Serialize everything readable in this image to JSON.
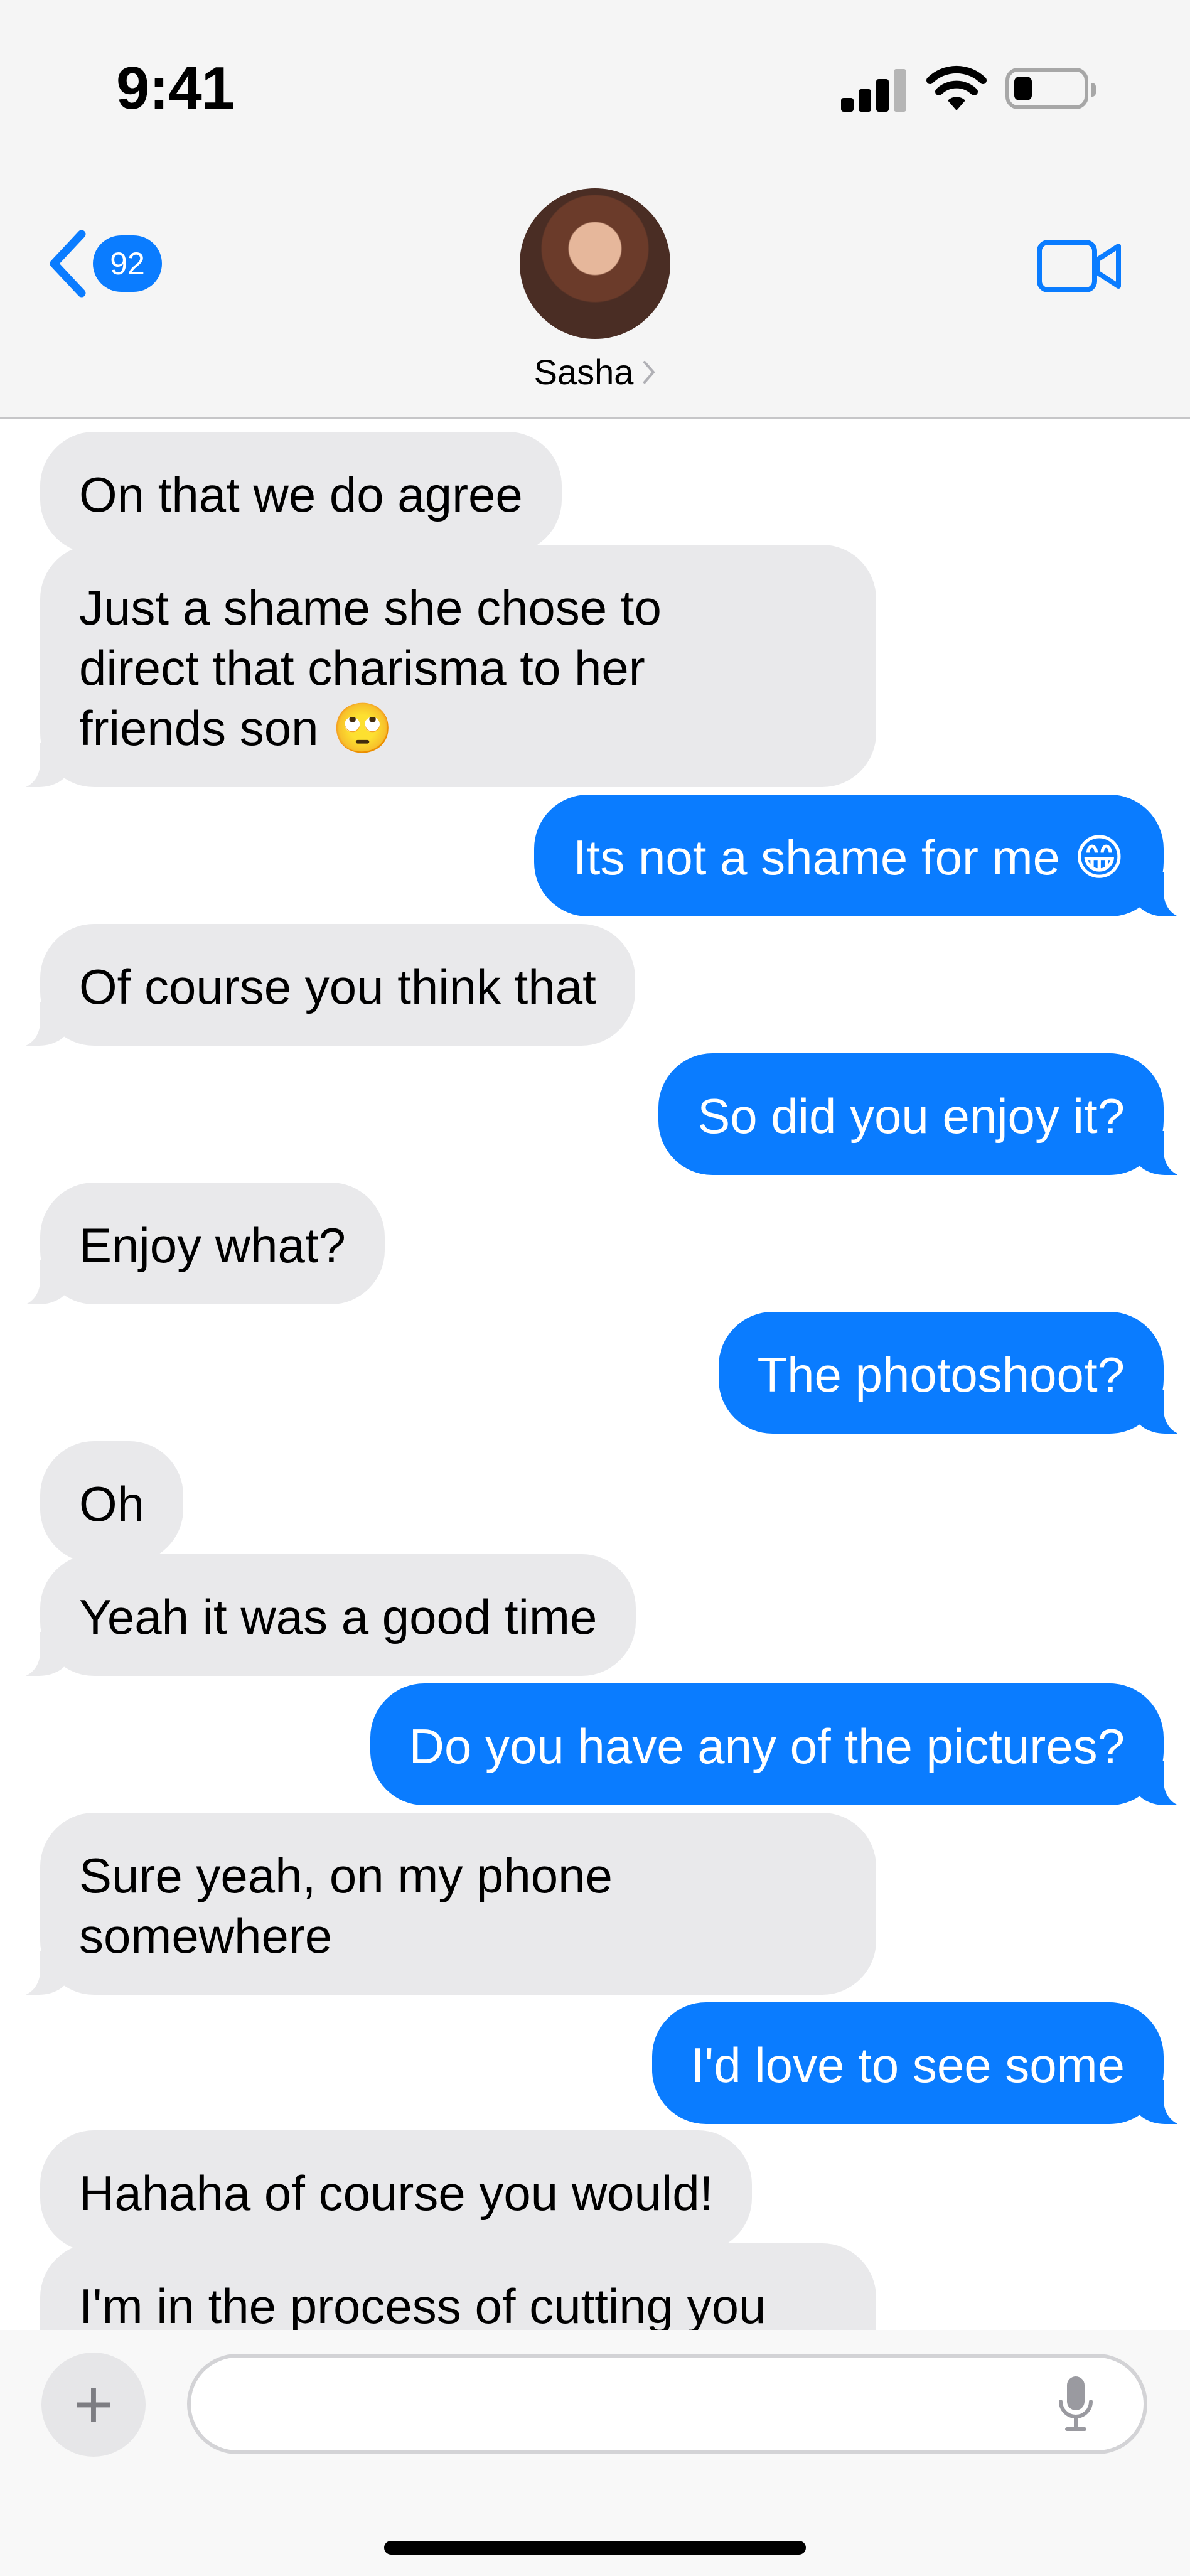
{
  "status_bar": {
    "time": "9:41"
  },
  "header": {
    "back_badge_count": "92",
    "contact_name": "Sasha"
  },
  "messages": [
    {
      "side": "in",
      "text": "On that we do agree"
    },
    {
      "side": "in",
      "text": "Just a shame she chose to\ndirect that charisma to her\nfriends son 🙄"
    },
    {
      "side": "out",
      "text": "Its not a shame for me 😁"
    },
    {
      "side": "in",
      "text": "Of course you think that"
    },
    {
      "side": "out",
      "text": "So did you enjoy it?"
    },
    {
      "side": "in",
      "text": "Enjoy what?"
    },
    {
      "side": "out",
      "text": "The photoshoot?"
    },
    {
      "side": "in",
      "text": "Oh"
    },
    {
      "side": "in",
      "text": "Yeah it was a good time"
    },
    {
      "side": "out",
      "text": "Do you have any of the pictures?"
    },
    {
      "side": "in",
      "text": "Sure yeah, on my phone\nsomewhere"
    },
    {
      "side": "out",
      "text": "I'd love to see some"
    },
    {
      "side": "in",
      "text": "Hahaha of course you would!"
    },
    {
      "side": "in",
      "text": "I'm in the process of cutting you\noff so maybe 😉"
    }
  ],
  "composer": {
    "input_value": "",
    "input_placeholder": ""
  },
  "colors": {
    "outgoing_bubble": "#0a7cff",
    "incoming_bubble": "#e9e9eb",
    "header_bg": "#f5f5f5"
  },
  "icons": [
    "signal-icon",
    "wifi-icon",
    "battery-icon",
    "back-chevron-icon",
    "video-camera-icon",
    "plus-icon",
    "microphone-icon"
  ]
}
